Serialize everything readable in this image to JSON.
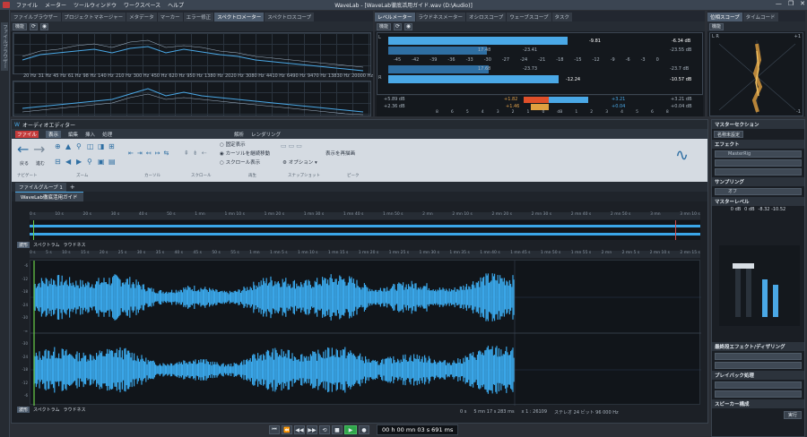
{
  "titlebar": {
    "title": "WaveLab - [WaveLab徹底活用ガイド.wav (D:\\Audio)]",
    "menus": [
      "ファイル",
      "メーター",
      "ツールウィンドウ",
      "ワークスペース",
      "ヘルプ"
    ],
    "min": "—",
    "max": "❐",
    "close": "✕"
  },
  "sidebar": {
    "label": "ファイルブラウザー"
  },
  "top_left": {
    "tabs": [
      "ファイルブラウザー",
      "プロジェクトマネージャー",
      "メタデータ",
      "マーカー",
      "エラー修正",
      "スペクトロメーター",
      "スペクトロスコープ"
    ],
    "active": 5,
    "toolbar_label": "機能",
    "freq_labels": [
      "20 Hz",
      "31 Hz",
      "45 Hz",
      "61 Hz",
      "98 Hz",
      "140 Hz",
      "210 Hz",
      "300 Hz",
      "450 Hz",
      "620 Hz",
      "950 Hz",
      "1380 Hz",
      "2020 Hz",
      "3080 Hz",
      "4410 Hz",
      "6490 Hz",
      "9470 Hz",
      "13830 Hz",
      "20000 Hz"
    ]
  },
  "levels": {
    "tabs": [
      "レベルメーター",
      "ラウドネスメーター",
      "オシロスコープ",
      "ウェーブスコープ",
      "タスク"
    ],
    "active": 0,
    "toolbar_label": "機能",
    "scale": [
      "-45",
      "-42",
      "-39",
      "-36",
      "-33",
      "-30",
      "-27",
      "-24",
      "-21",
      "-18",
      "-15",
      "-12",
      "-9",
      "-6",
      "-3",
      "0"
    ],
    "l_peak": "-9.81",
    "r_peak": "-12.24",
    "l_max": "-6.34 dB",
    "r_max": "-10.57 dB",
    "l_rms_max": "-23.55 dB",
    "r_rms_max": "-23.7 dB",
    "l_label": "L",
    "r_label": "R",
    "rms_l": "17.48",
    "rms_r": "17.68",
    "rms_l2": "-23.41",
    "rms_r2": "-23.73",
    "bal_left1": "+5.89 dB",
    "bal_left2": "+2.36 dB",
    "bal_mid1": "+1.82",
    "bal_mid2": "+1.46",
    "bal_right1": "+3.21",
    "bal_right2": "+0.04",
    "bal_far1": "+3.21 dB",
    "bal_far2": "+0.04 dB",
    "bal_scale": [
      "8",
      "6",
      "5",
      "4",
      "3",
      "2",
      "1",
      "0",
      "1",
      "2",
      "3",
      "4",
      "5",
      "6",
      "8"
    ],
    "bal_unit": "dB"
  },
  "phase": {
    "tabs": [
      "位相スコープ",
      "タイムコード"
    ],
    "active": 0,
    "toolbar_label": "機能",
    "lr_label": "L R",
    "max": "+1",
    "min": "-1"
  },
  "editor": {
    "title": "オーディオエディター",
    "menu_tabs": [
      "ファイル",
      "表示",
      "編集",
      "挿入",
      "処理",
      "",
      "",
      "",
      "",
      "",
      "",
      "",
      "",
      "",
      "",
      "",
      "",
      "",
      "",
      "",
      "",
      "",
      "解析",
      "レンダリング"
    ],
    "active_tab": "表示",
    "groups": [
      "ナビゲート",
      "ズーム",
      "カーソル",
      "スクロール",
      "再生",
      "スナップショット",
      "ピーク"
    ],
    "back": "戻る",
    "forward": "進む",
    "radio": [
      "固定表示",
      "カーソルを継続移動",
      "スクロール表示"
    ],
    "radio_selected": 1,
    "option": "オプション",
    "redraw": "表示を再描画",
    "file_group": "ファイルグループ 1",
    "add": "+",
    "file_tab": "WaveLab徹底活用ガイド",
    "ruler": [
      "0 s",
      "10 s",
      "20 s",
      "30 s",
      "40 s",
      "50 s",
      "1 mn",
      "1 mn 10 s",
      "1 mn 20 s",
      "1 mn 30 s",
      "1 mn 40 s",
      "1 mn 50 s",
      "2 mn",
      "2 mn 10 s",
      "2 mn 20 s",
      "2 mn 30 s",
      "2 mn 40 s",
      "2 mn 50 s",
      "3 mn",
      "3 mn 10 s"
    ],
    "main_ruler": [
      "0 s",
      "5 s",
      "10 s",
      "15 s",
      "20 s",
      "25 s",
      "30 s",
      "35 s",
      "40 s",
      "45 s",
      "50 s",
      "55 s",
      "1 mn",
      "1 mn 5 s",
      "1 mn 10 s",
      "1 mn 15 s",
      "1 mn 20 s",
      "1 mn 25 s",
      "1 mn 30 s",
      "1 mn 35 s",
      "1 mn 40 s",
      "1 mn 45 s",
      "1 mn 50 s",
      "1 mn 55 s",
      "2 mn",
      "2 mn 5 s",
      "2 mn 10 s",
      "2 mn 15 s"
    ],
    "view_tabs": [
      "波形",
      "スペクトラム",
      "ラウドネス"
    ],
    "db_labels": [
      "-6",
      "-12",
      "-18",
      "-24",
      "-30",
      "-∞",
      "-30",
      "-24",
      "-18",
      "-12",
      "-6"
    ],
    "status": {
      "pos": "0 s",
      "len": "5 mn 17 s 283 ms",
      "zoom": "x 1 : 26109",
      "format": "ステレオ 24 ビット 96 000 Hz"
    }
  },
  "master": {
    "title": "マスターセクション",
    "preset": "名称未設定",
    "effects": "エフェクト",
    "effect1": "MasterRig",
    "resampling": "サンプリング",
    "resample": "オフ",
    "master_level": "マスターレベル",
    "levels": "0 dB",
    "levels2": "0 dB",
    "peak": "-8.32 -10.52",
    "final": "最終段エフェクト/ディザリング",
    "playback": "プレイバック処理",
    "speaker": "スピーカー構成",
    "render": "実行"
  },
  "transport": {
    "time": "00 h 00 mn 03 s 691 ms"
  }
}
